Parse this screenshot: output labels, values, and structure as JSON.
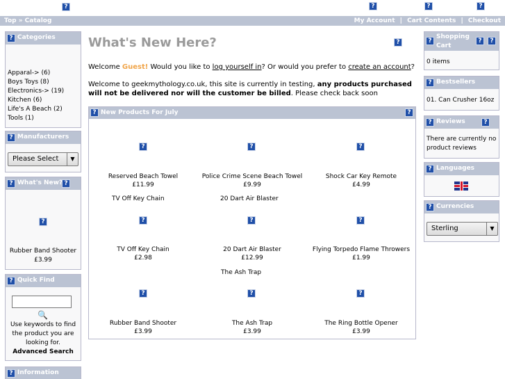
{
  "header": {
    "breadcrumb": "Top » Catalog",
    "links": [
      "My Account",
      "Cart Contents",
      "Checkout"
    ],
    "separator": "|"
  },
  "left": {
    "categories": {
      "title": "Categories",
      "items": [
        "Apparal-> (6)",
        "Boys Toys (8)",
        "Electronics-> (19)",
        "Kitchen (6)",
        "Life's A Beach (2)",
        "Tools (1)"
      ]
    },
    "manufacturers": {
      "title": "Manufacturers",
      "select_value": "Please Select"
    },
    "whats_new": {
      "title": "What's New?",
      "product_name": "Rubber Band Shooter",
      "product_price": "£3.99"
    },
    "quick_find": {
      "title": "Quick Find",
      "help_text": "Use keywords to find the product you are looking for.",
      "advanced_link": "Advanced Search"
    },
    "information": {
      "title": "Information"
    }
  },
  "main": {
    "title": "What's New Here?",
    "welcome": {
      "prefix": "Welcome ",
      "guest": "Guest!",
      "middle": " Would you like to ",
      "login_link": "log yourself in",
      "middle2": "? Or would you prefer to ",
      "create_link": "create an account",
      "suffix": "?"
    },
    "notice": {
      "part1": "Welcome to geekmythology.co.uk, this site is currently in testing, ",
      "bold": "any products purchased will not be delivered nor will the customer be billed",
      "part2": ". Please check back soon"
    },
    "new_products": {
      "title": "New Products For July",
      "products": [
        {
          "name": "Reserved Beach Towel",
          "price": "£11.99"
        },
        {
          "name": "Police Crime Scene Beach Towel",
          "price": "£9.99"
        },
        {
          "name": "Shock Car Key Remote",
          "price": "£4.99"
        },
        {
          "name": "TV Off Key Chain",
          "price": "£2.98"
        },
        {
          "name": "20 Dart Air Blaster",
          "price": "£12.99"
        },
        {
          "name": "Flying Torpedo Flame Throwers",
          "price": "£1.99"
        },
        {
          "name": "Rubber Band Shooter",
          "price": "£3.99"
        },
        {
          "name": "The Ash Trap",
          "price": "£3.99"
        },
        {
          "name": "The Ring Bottle Opener",
          "price": "£3.99"
        }
      ],
      "image_labels": [
        "TV Off Key Chain",
        "20 Dart Air Blaster",
        "The Ash Trap"
      ]
    }
  },
  "right": {
    "cart": {
      "title": "Shopping Cart",
      "contents": "0 items"
    },
    "bestsellers": {
      "title": "Bestsellers",
      "item": "01. Can Crusher 16oz"
    },
    "reviews": {
      "title": "Reviews",
      "text": "There are currently no product reviews"
    },
    "languages": {
      "title": "Languages",
      "flag_icon": "uk-flag-icon"
    },
    "currencies": {
      "title": "Currencies",
      "select_value": "Sterling"
    }
  },
  "colors": {
    "bar": "#bbc3d3",
    "border": "#b6b7cb",
    "guest": "#f0a54a",
    "title_gray": "#9a9a9a",
    "icon_blue": "#1f4fa8"
  }
}
